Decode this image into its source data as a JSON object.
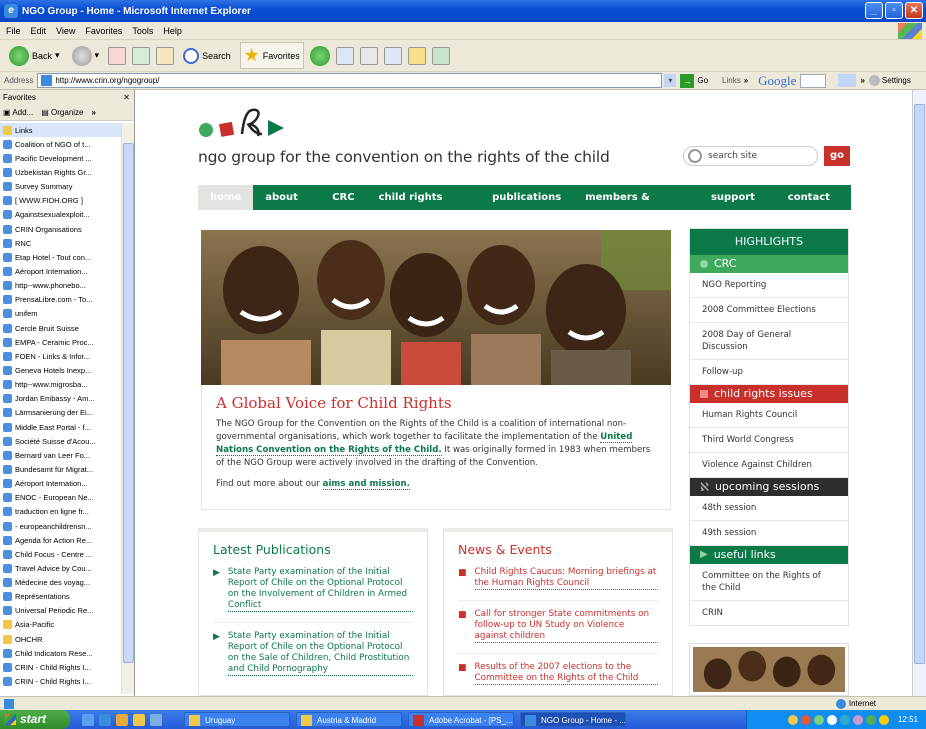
{
  "window": {
    "title": "NGO Group - Home - Microsoft Internet Explorer"
  },
  "menubar": [
    "File",
    "Edit",
    "View",
    "Favorites",
    "Tools",
    "Help"
  ],
  "toolbar": {
    "back": "Back",
    "search": "Search",
    "favorites": "Favorites"
  },
  "address": {
    "label": "Address",
    "url": "http://www.crin.org/ngogroup/",
    "go": "Go",
    "links": "Links",
    "google": "Google",
    "settings": "Settings"
  },
  "favorites": {
    "title": "Favorites",
    "add": "Add...",
    "organize": "Organize",
    "items": [
      {
        "label": "Links",
        "folder": true
      },
      {
        "label": "Coalition of NGO of t..."
      },
      {
        "label": "Pacific Development ..."
      },
      {
        "label": "Uzbekistan Rights Gr..."
      },
      {
        "label": "Survey Summary"
      },
      {
        "label": "[ WWW.FIDH.ORG ]"
      },
      {
        "label": "Againstsexualexploit..."
      },
      {
        "label": "CRIN Organisations"
      },
      {
        "label": "RNC"
      },
      {
        "label": "Etap Hotel - Tout con..."
      },
      {
        "label": "Aéroport Internation..."
      },
      {
        "label": "http--www.phonebo..."
      },
      {
        "label": "PrensaLibre.com - To..."
      },
      {
        "label": "unifem"
      },
      {
        "label": "Cercle Bruit Suisse"
      },
      {
        "label": "EMPA - Ceramic Proc..."
      },
      {
        "label": "FOEN - Links & Infor..."
      },
      {
        "label": "Geneva Hotels Inexp..."
      },
      {
        "label": "http--www.migrosba..."
      },
      {
        "label": "Jordan Embassy - Am..."
      },
      {
        "label": "Lärmsanierung der Ei..."
      },
      {
        "label": "Middle East Portal - f..."
      },
      {
        "label": "Société Suisse d'Acou..."
      },
      {
        "label": "Bernard van Leer Fo..."
      },
      {
        "label": "Bundesamt für Migrat..."
      },
      {
        "label": "Aéroport Internation..."
      },
      {
        "label": "ENOC - European Ne..."
      },
      {
        "label": "traduction en ligne fr..."
      },
      {
        "label": "- europeanchildrensn..."
      },
      {
        "label": "Agenda for Action Re..."
      },
      {
        "label": "Child Focus - Centre ..."
      },
      {
        "label": "Travel Advice by Cou..."
      },
      {
        "label": "Médecine des voyag..."
      },
      {
        "label": "Représentations"
      },
      {
        "label": "Universal Periodic Re..."
      },
      {
        "label": "Asia-Pacific",
        "folder": true
      },
      {
        "label": "OHCHR",
        "folder": true
      },
      {
        "label": "Child Indicators Rese..."
      },
      {
        "label": "CRIN - Child Rights I..."
      },
      {
        "label": "CRIN - Child Rights I..."
      }
    ]
  },
  "site": {
    "title": "ngo group for the convention on the rights of the child",
    "search_placeholder": "search site",
    "go": "go",
    "nav": [
      "home",
      "about us",
      "CRC",
      "child rights issues",
      "publications",
      "members & partners",
      "support us",
      "contact us"
    ],
    "intro": {
      "heading": "A Global Voice for Child Rights",
      "p1a": "The NGO Group for the Convention on the Rights of the Child is a coalition of international non-governmental organisations, which work together to facilitate the implementation of the ",
      "p1link": "United Nations Convention on the Rights of the Child.",
      "p1b": " It was originally formed in 1983 when members of the NGO Group were actively involved in the drafting of the Convention.",
      "p2a": "Find out more about our ",
      "p2link": "aims and mission."
    },
    "publications": {
      "heading": "Latest Publications",
      "items": [
        "State Party examination of the Initial Report of Chile on the Optional Protocol on the Involvement of Children in Armed Conflict",
        "State Party examination of the Initial Report of Chile on the Optional Protocol on the Sale of Children, Child Prostitution and Child Pornography"
      ]
    },
    "news": {
      "heading": "News & Events",
      "items": [
        "Child Rights Caucus: Morning briefings at the Human Rights Council",
        "Call for stronger State commitments on follow-up to UN Study on Violence against children",
        "Results of the 2007 elections to the Committee on the Rights of the Child"
      ]
    },
    "highlights": {
      "title": "HIGHLIGHTS",
      "sections": [
        {
          "title": "CRC",
          "style": "green",
          "items": [
            "NGO Reporting",
            "2008 Committee Elections",
            "2008 Day of General Discussion",
            "Follow-up"
          ]
        },
        {
          "title": "child rights issues",
          "style": "red",
          "items": [
            "Human Rights Council",
            "Third World Congress",
            "Violence Against Children"
          ]
        },
        {
          "title": "upcoming sessions",
          "style": "dark",
          "items": [
            "48th session",
            "49th session"
          ]
        },
        {
          "title": "useful links",
          "style": "dgreen",
          "items": [
            "Committee on the Rights of the Child",
            "CRIN"
          ]
        }
      ]
    }
  },
  "status": {
    "zone": "Internet"
  },
  "taskbar": {
    "start": "start",
    "tasks": [
      "Uruguay",
      "Austria & Madrid",
      "Adobe Acrobat - [PS_...",
      "NGO Group - Home - ..."
    ],
    "clock": "12:51"
  },
  "colors": {
    "green": "#0b7a48",
    "red": "#c9302c",
    "light_green": "#3ea85c"
  }
}
